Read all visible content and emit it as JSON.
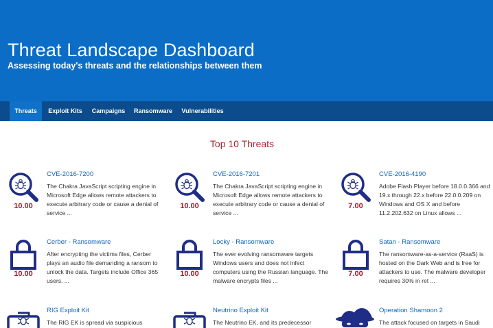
{
  "header": {
    "title": "Threat Landscape Dashboard",
    "subtitle": "Assessing today's threats and the relationships between them"
  },
  "nav": {
    "tabs": [
      {
        "label": "Threats",
        "active": true
      },
      {
        "label": "Exploit Kits",
        "active": false
      },
      {
        "label": "Campaigns",
        "active": false
      },
      {
        "label": "Ransomware",
        "active": false
      },
      {
        "label": "Vulnerabilities",
        "active": false
      }
    ]
  },
  "section": {
    "title": "Top 10 Threats"
  },
  "colors": {
    "header_bg": "#0c6dc6",
    "nav_bg": "#0c4b8c",
    "nav_active": "#0f71c8",
    "icon_navy": "#1f2d86",
    "score": "#a3192b",
    "link": "#0f65b8"
  },
  "threats": [
    {
      "icon": "bug-magnifier-icon",
      "title": "CVE-2016-7200",
      "score": "10.00",
      "description": "The Chakra JavaScript scripting engine in Microsoft Edge allows remote attackers to execute arbitrary code or cause a denial of service ..."
    },
    {
      "icon": "bug-magnifier-icon",
      "title": "CVE-2016-7201",
      "score": "10.00",
      "description": "The Chakra JavaScript scripting engine in Microsoft Edge allows remote attackers to execute arbitrary code or cause a denial of service ..."
    },
    {
      "icon": "bug-magnifier-icon",
      "title": "CVE-2016-4190",
      "score": "7.00",
      "description": "Adobe Flash Player before 18.0.0.366 and 19.x through 22.x before 22.0.0.209 on Windows and OS X and before 11.2.202.632 on Linux allows ..."
    },
    {
      "icon": "padlock-icon",
      "title": "Cerber - Ransomware",
      "score": "10.00",
      "description": "After encrypting the victims files, Cerber plays an audio file demanding a ransom to unlock the data. Targets include Office 365 users. ..."
    },
    {
      "icon": "padlock-icon",
      "title": "Locky - Ransomware",
      "score": "10.00",
      "description": "The ever evolving ransomware targets Windows users and does not infect computers using the Russian language. The malware encrypts files ..."
    },
    {
      "icon": "padlock-icon",
      "title": "Satan - Ransomware",
      "score": "7.00",
      "description": "The ransomware-as-a-service (RaaS) is hosted on the Dark Web and is free for attackers to use. The malware developer requires 30% in ret ..."
    },
    {
      "icon": "bug-briefcase-icon",
      "title": "RIG Exploit Kit",
      "score": "",
      "description": "The RIG EK is spread via suspicious"
    },
    {
      "icon": "bug-briefcase-icon",
      "title": "Neutrino Exploit Kit",
      "score": "",
      "description": "The Neutrino EK, and its predecessor"
    },
    {
      "icon": "hacker-group-icon",
      "title": "Operation Shamoon 2",
      "score": "",
      "description": "The attack focused on targets in Saudi"
    }
  ]
}
